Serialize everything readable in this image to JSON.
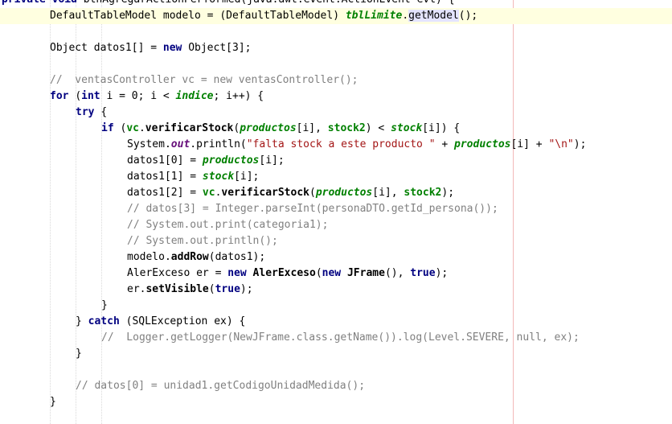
{
  "lines": [
    {
      "indent": 2,
      "cls": "top",
      "parts": [
        {
          "t": "private ",
          "c": "kw"
        },
        {
          "t": "void ",
          "c": "kw"
        },
        {
          "t": "btnAgregarActionPerformed(java.awt.event.ActionEvent evt) {",
          "c": ""
        }
      ]
    },
    {
      "indent": 62,
      "current": true,
      "parts": [
        {
          "t": "DefaultTableModel modelo = (DefaultTableModel) ",
          "c": ""
        },
        {
          "t": "tblLimite",
          "c": "fld"
        },
        {
          "t": ".",
          "c": ""
        },
        {
          "t": "getModel",
          "c": "hl"
        },
        {
          "t": "();",
          "c": ""
        }
      ]
    },
    {
      "indent": 62,
      "parts": []
    },
    {
      "indent": 62,
      "parts": [
        {
          "t": "Object datos1[] = ",
          "c": ""
        },
        {
          "t": "new ",
          "c": "kw"
        },
        {
          "t": "Object[3];",
          "c": ""
        }
      ]
    },
    {
      "indent": 62,
      "parts": []
    },
    {
      "indent": 62,
      "parts": [
        {
          "t": "//  ventasController vc = new ventasController();",
          "c": "cmt"
        }
      ]
    },
    {
      "indent": 62,
      "parts": [
        {
          "t": "for ",
          "c": "kw"
        },
        {
          "t": "(",
          "c": ""
        },
        {
          "t": "int ",
          "c": "kw"
        },
        {
          "t": "i = 0; i < ",
          "c": ""
        },
        {
          "t": "indice",
          "c": "fld"
        },
        {
          "t": "; i++) {",
          "c": ""
        }
      ]
    },
    {
      "indent": 94,
      "parts": [
        {
          "t": "try ",
          "c": "kw"
        },
        {
          "t": "{",
          "c": ""
        }
      ]
    },
    {
      "indent": 126,
      "parts": [
        {
          "t": "if ",
          "c": "kw"
        },
        {
          "t": "(",
          "c": ""
        },
        {
          "t": "vc",
          "c": "fld2"
        },
        {
          "t": ".",
          "c": ""
        },
        {
          "t": "verificarStock",
          "c": "meth"
        },
        {
          "t": "(",
          "c": ""
        },
        {
          "t": "productos",
          "c": "fld"
        },
        {
          "t": "[i], ",
          "c": ""
        },
        {
          "t": "stock2",
          "c": "fld2"
        },
        {
          "t": ") < ",
          "c": ""
        },
        {
          "t": "stock",
          "c": "fld"
        },
        {
          "t": "[i]) {",
          "c": ""
        }
      ]
    },
    {
      "indent": 158,
      "parts": [
        {
          "t": "System.",
          "c": ""
        },
        {
          "t": "out",
          "c": "out"
        },
        {
          "t": ".println(",
          "c": ""
        },
        {
          "t": "\"falta stock a este producto \"",
          "c": "str"
        },
        {
          "t": " + ",
          "c": ""
        },
        {
          "t": "productos",
          "c": "fld"
        },
        {
          "t": "[i] + ",
          "c": ""
        },
        {
          "t": "\"\\n\"",
          "c": "str"
        },
        {
          "t": ");",
          "c": ""
        }
      ]
    },
    {
      "indent": 158,
      "parts": [
        {
          "t": "datos1[0] = ",
          "c": ""
        },
        {
          "t": "productos",
          "c": "fld"
        },
        {
          "t": "[i];",
          "c": ""
        }
      ]
    },
    {
      "indent": 158,
      "parts": [
        {
          "t": "datos1[1] = ",
          "c": ""
        },
        {
          "t": "stock",
          "c": "fld"
        },
        {
          "t": "[i];",
          "c": ""
        }
      ]
    },
    {
      "indent": 158,
      "parts": [
        {
          "t": "datos1[2] = ",
          "c": ""
        },
        {
          "t": "vc",
          "c": "fld2"
        },
        {
          "t": ".",
          "c": ""
        },
        {
          "t": "verificarStock",
          "c": "meth"
        },
        {
          "t": "(",
          "c": ""
        },
        {
          "t": "productos",
          "c": "fld"
        },
        {
          "t": "[i], ",
          "c": ""
        },
        {
          "t": "stock2",
          "c": "fld2"
        },
        {
          "t": ");",
          "c": ""
        }
      ]
    },
    {
      "indent": 158,
      "parts": [
        {
          "t": "// datos[3] = Integer.parseInt(personaDTO.getId_persona());",
          "c": "cmt"
        }
      ]
    },
    {
      "indent": 158,
      "parts": [
        {
          "t": "// System.out.print(categoria1);",
          "c": "cmt"
        }
      ]
    },
    {
      "indent": 158,
      "parts": [
        {
          "t": "// System.out.println();",
          "c": "cmt"
        }
      ]
    },
    {
      "indent": 158,
      "parts": [
        {
          "t": "modelo.",
          "c": ""
        },
        {
          "t": "addRow",
          "c": "meth"
        },
        {
          "t": "(datos1);",
          "c": ""
        }
      ]
    },
    {
      "indent": 158,
      "parts": [
        {
          "t": "AlerExceso er = ",
          "c": ""
        },
        {
          "t": "new ",
          "c": "kw"
        },
        {
          "t": "AlerExceso",
          "c": "meth"
        },
        {
          "t": "(",
          "c": ""
        },
        {
          "t": "new ",
          "c": "kw"
        },
        {
          "t": "JFrame",
          "c": "meth"
        },
        {
          "t": "(), ",
          "c": ""
        },
        {
          "t": "true",
          "c": "kw"
        },
        {
          "t": ");",
          "c": ""
        }
      ]
    },
    {
      "indent": 158,
      "parts": [
        {
          "t": "er.",
          "c": ""
        },
        {
          "t": "setVisible",
          "c": "meth"
        },
        {
          "t": "(",
          "c": ""
        },
        {
          "t": "true",
          "c": "kw"
        },
        {
          "t": ");",
          "c": ""
        }
      ]
    },
    {
      "indent": 126,
      "parts": [
        {
          "t": "}",
          "c": ""
        }
      ]
    },
    {
      "indent": 94,
      "parts": [
        {
          "t": "} ",
          "c": ""
        },
        {
          "t": "catch ",
          "c": "kw"
        },
        {
          "t": "(SQLException ex) {",
          "c": ""
        }
      ]
    },
    {
      "indent": 126,
      "parts": [
        {
          "t": "//  Logger.getLogger(NewJFrame.class.getName()).log(Level.SEVERE, null, ex);",
          "c": "cmt"
        }
      ]
    },
    {
      "indent": 94,
      "parts": [
        {
          "t": "}",
          "c": ""
        }
      ]
    },
    {
      "indent": 94,
      "parts": []
    },
    {
      "indent": 94,
      "parts": [
        {
          "t": "// datos[0] = unidad1.getCodigoUnidadMedida();",
          "c": "cmt"
        }
      ]
    },
    {
      "indent": 62,
      "parts": [
        {
          "t": "}",
          "c": ""
        }
      ]
    }
  ]
}
